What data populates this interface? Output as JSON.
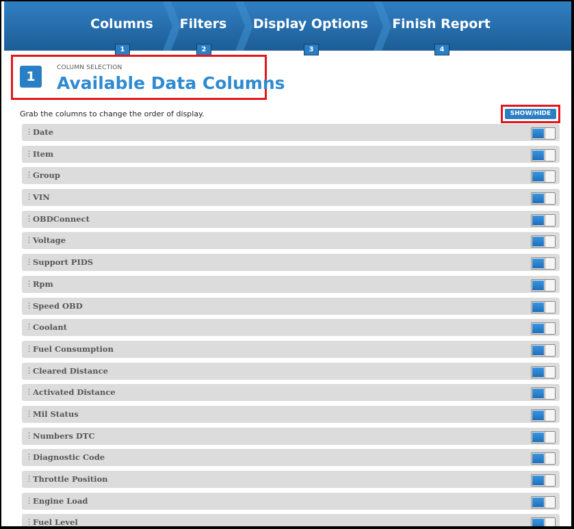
{
  "wizard": {
    "steps": [
      {
        "label": "Columns",
        "number": "1"
      },
      {
        "label": "Filters",
        "number": "2"
      },
      {
        "label": "Display Options",
        "number": "3"
      },
      {
        "label": "Finish Report",
        "number": "4"
      }
    ]
  },
  "section": {
    "badge": "1",
    "overline": "COLUMN SELECTION",
    "title": "Available Data Columns"
  },
  "hint": "Grab the columns to change the order of display.",
  "show_hide_label": "SHOW/HIDE",
  "columns": [
    {
      "label": "Date",
      "visible": true
    },
    {
      "label": "Item",
      "visible": true
    },
    {
      "label": "Group",
      "visible": true
    },
    {
      "label": "VIN",
      "visible": true
    },
    {
      "label": "OBDConnect",
      "visible": true
    },
    {
      "label": "Voltage",
      "visible": true
    },
    {
      "label": "Support PIDS",
      "visible": true
    },
    {
      "label": "Rpm",
      "visible": true
    },
    {
      "label": "Speed OBD",
      "visible": true
    },
    {
      "label": "Coolant",
      "visible": true
    },
    {
      "label": "Fuel Consumption",
      "visible": true
    },
    {
      "label": "Cleared Distance",
      "visible": true
    },
    {
      "label": "Activated Distance",
      "visible": true
    },
    {
      "label": "Mil Status",
      "visible": true
    },
    {
      "label": "Numbers DTC",
      "visible": true
    },
    {
      "label": "Diagnostic Code",
      "visible": true
    },
    {
      "label": "Throttle Position",
      "visible": true
    },
    {
      "label": "Engine Load",
      "visible": true
    },
    {
      "label": "Fuel Level",
      "visible": true
    }
  ],
  "colors": {
    "accent": "#2a7fc4",
    "highlight": "#e3151a",
    "row_bg": "#dcdcdc"
  },
  "icons": {
    "grip": "drag-handle-icon"
  }
}
